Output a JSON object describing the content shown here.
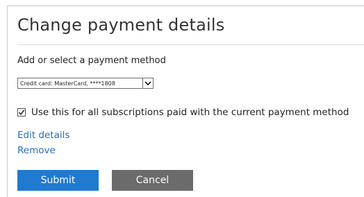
{
  "dialog": {
    "title": "Change payment details",
    "section_label": "Add or select a payment method"
  },
  "payment_method": {
    "selected": "Credit card: MasterCard, ****1808",
    "dropdown_icon": "chevron-down-icon"
  },
  "subscriptions_option": {
    "checked": true,
    "label": "Use this for all subscriptions paid with the current payment method"
  },
  "links": {
    "edit": "Edit details",
    "remove": "Remove"
  },
  "buttons": {
    "submit": "Submit",
    "cancel": "Cancel"
  },
  "colors": {
    "link": "#2a6ebb",
    "submit": "#1f7ad0",
    "cancel": "#6b6b6b"
  }
}
